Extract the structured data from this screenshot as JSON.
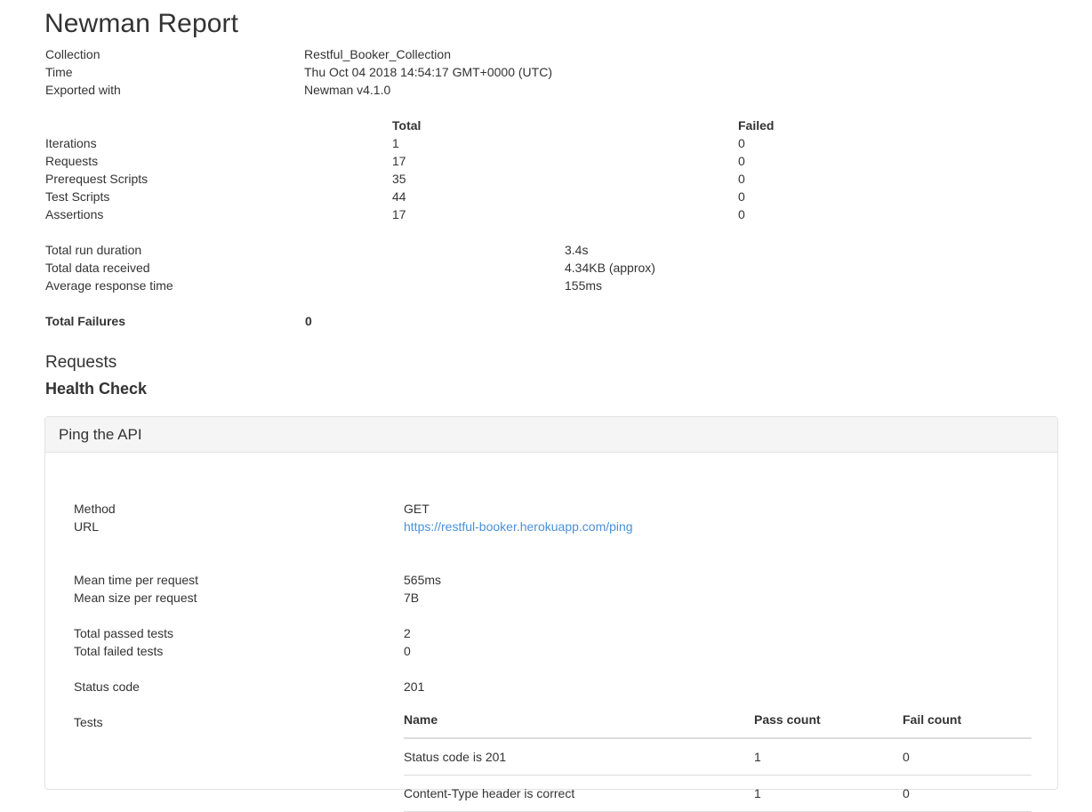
{
  "report": {
    "title": "Newman Report",
    "meta": [
      {
        "label": "Collection",
        "value": "Restful_Booker_Collection"
      },
      {
        "label": "Time",
        "value": "Thu Oct 04 2018 14:54:17 GMT+0000 (UTC)"
      },
      {
        "label": "Exported with",
        "value": "Newman v4.1.0"
      }
    ],
    "stats": {
      "columns": {
        "total": "Total",
        "failed": "Failed"
      },
      "rows": [
        {
          "label": "Iterations",
          "total": "1",
          "failed": "0"
        },
        {
          "label": "Requests",
          "total": "17",
          "failed": "0"
        },
        {
          "label": "Prerequest Scripts",
          "total": "35",
          "failed": "0"
        },
        {
          "label": "Test Scripts",
          "total": "44",
          "failed": "0"
        },
        {
          "label": "Assertions",
          "total": "17",
          "failed": "0"
        }
      ]
    },
    "run_summary": [
      {
        "label": "Total run duration",
        "value": "3.4s"
      },
      {
        "label": "Total data received",
        "value": "4.34KB (approx)"
      },
      {
        "label": "Average response time",
        "value": "155ms"
      }
    ],
    "total_failures": {
      "label": "Total Failures",
      "value": "0"
    }
  },
  "requests_section": {
    "heading": "Requests",
    "folder": "Health Check",
    "request": {
      "name": "Ping the API",
      "details": [
        {
          "label": "Method",
          "value": "GET"
        },
        {
          "label": "URL",
          "value": "https://restful-booker.herokuapp.com/ping",
          "link": true
        }
      ],
      "metrics": [
        {
          "label": "Mean time per request",
          "value": "565ms"
        },
        {
          "label": "Mean size per request",
          "value": "7B"
        }
      ],
      "test_counts": [
        {
          "label": "Total passed tests",
          "value": "2"
        },
        {
          "label": "Total failed tests",
          "value": "0"
        }
      ],
      "status": {
        "label": "Status code",
        "value": "201"
      },
      "tests": {
        "label": "Tests",
        "columns": [
          "Name",
          "Pass count",
          "Fail count"
        ],
        "rows": [
          {
            "name": "Status code is 201",
            "pass": "1",
            "fail": "0"
          },
          {
            "name": "Content-Type header is correct",
            "pass": "1",
            "fail": "0"
          }
        ]
      }
    }
  },
  "colors": {
    "text": "#333333",
    "link": "#4a90d9",
    "panel_heading_bg": "#f5f5f5",
    "border": "#e3e3e3",
    "table_border": "#dddddd"
  }
}
